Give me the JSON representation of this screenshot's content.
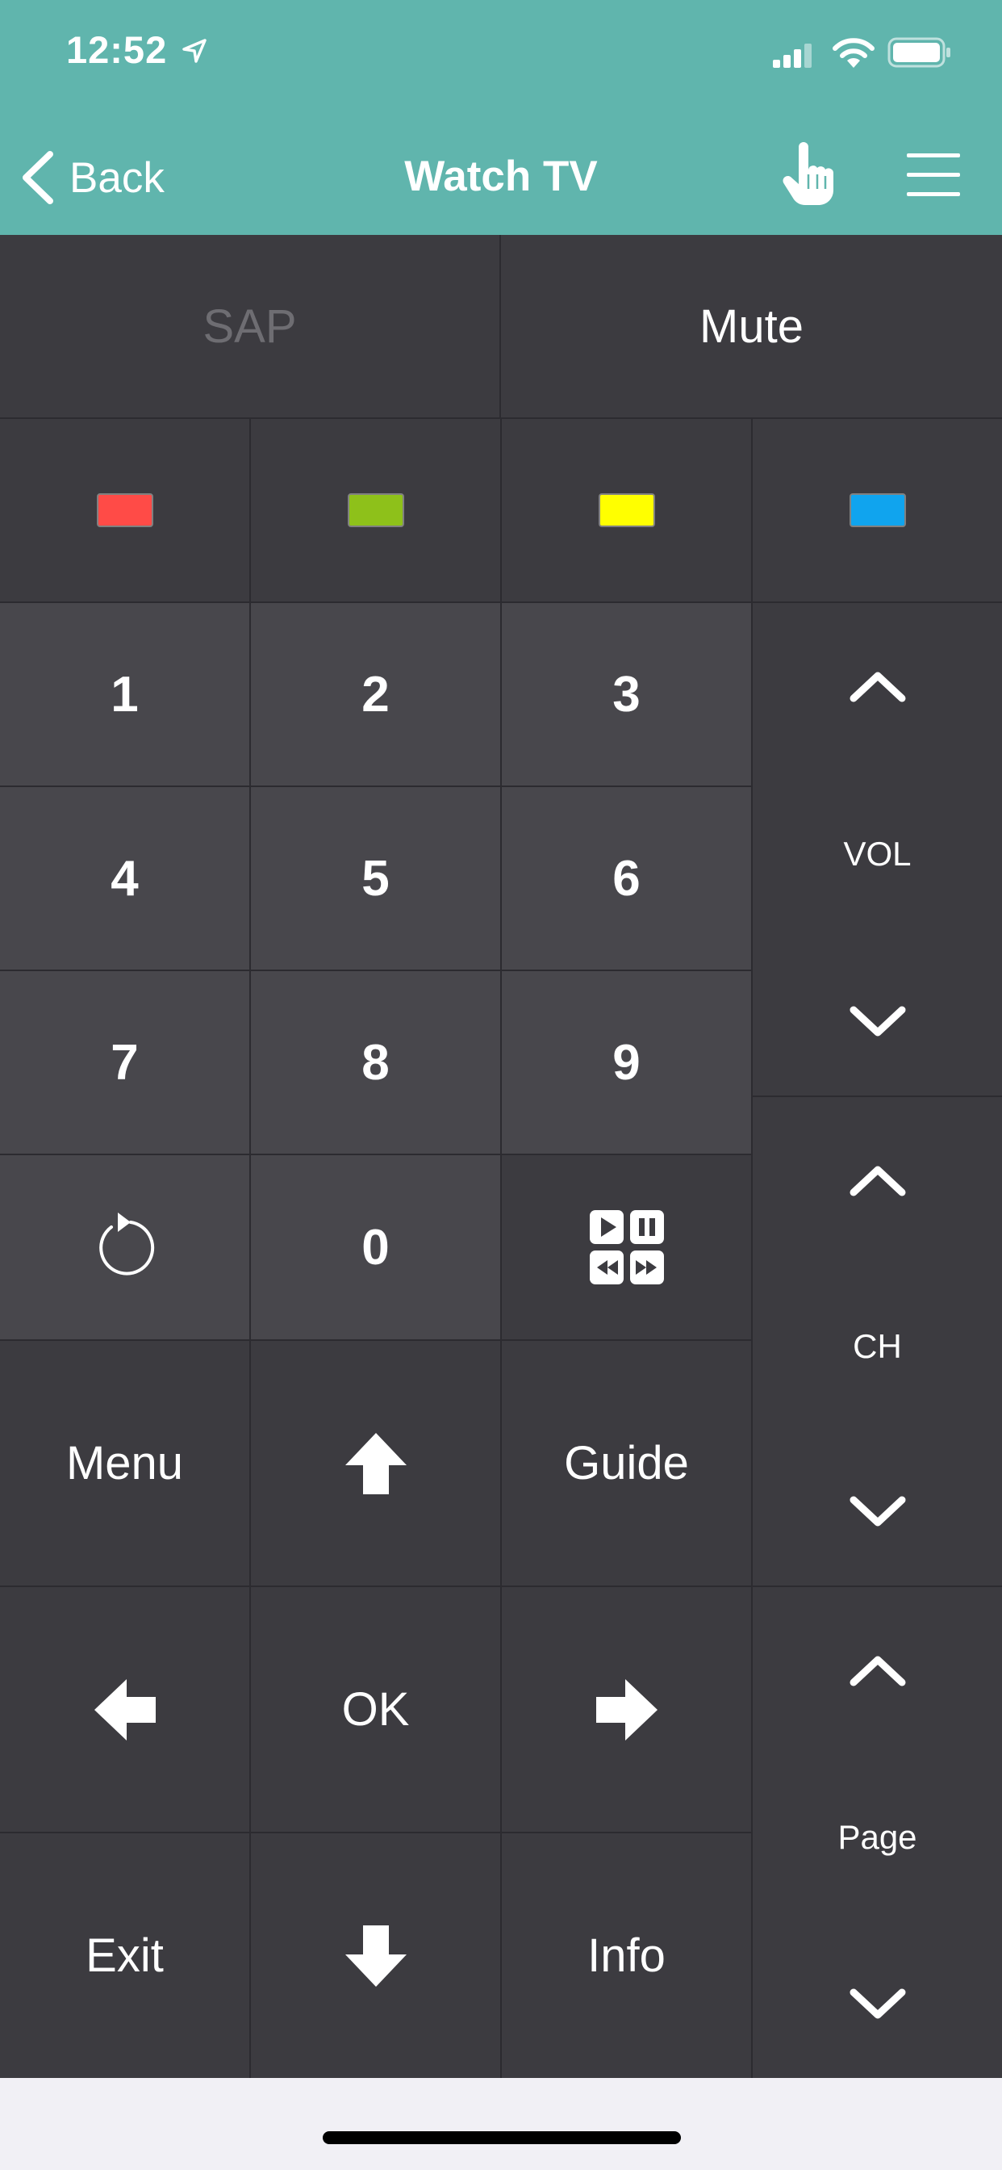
{
  "status_bar": {
    "time": "12:52"
  },
  "header": {
    "back_label": "Back",
    "title": "Watch TV"
  },
  "colors": {
    "header_bg": "#60b5ad",
    "red": "#ff4b47",
    "green": "#8ec11a",
    "yellow": "#ffff00",
    "blue": "#10a4ee"
  },
  "remote": {
    "sap_label": "SAP",
    "mute_label": "Mute",
    "color_buttons": [
      "red",
      "green",
      "yellow",
      "blue"
    ],
    "numbers": [
      "1",
      "2",
      "3",
      "4",
      "5",
      "6",
      "7",
      "8",
      "9",
      "0"
    ],
    "vol_label": "VOL",
    "ch_label": "CH",
    "page_label": "Page",
    "menu_label": "Menu",
    "guide_label": "Guide",
    "ok_label": "OK",
    "exit_label": "Exit",
    "info_label": "Info"
  }
}
